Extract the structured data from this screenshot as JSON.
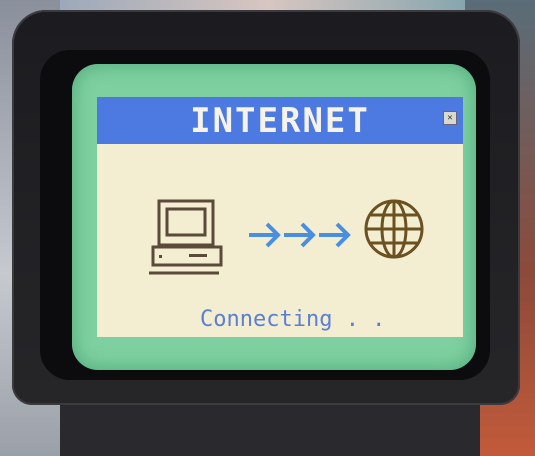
{
  "window": {
    "title": "INTERNET",
    "close_icon": "close-icon",
    "status_text": "Connecting . ."
  },
  "icons": [
    "computer-icon",
    "arrow-right-icon",
    "globe-icon"
  ],
  "colors": {
    "titlebar": "#4d7ae0",
    "body": "#f3eed2",
    "screen_border": "#7fd0a0",
    "arrows": "#4a8ee0",
    "globe": "#6b5020"
  }
}
